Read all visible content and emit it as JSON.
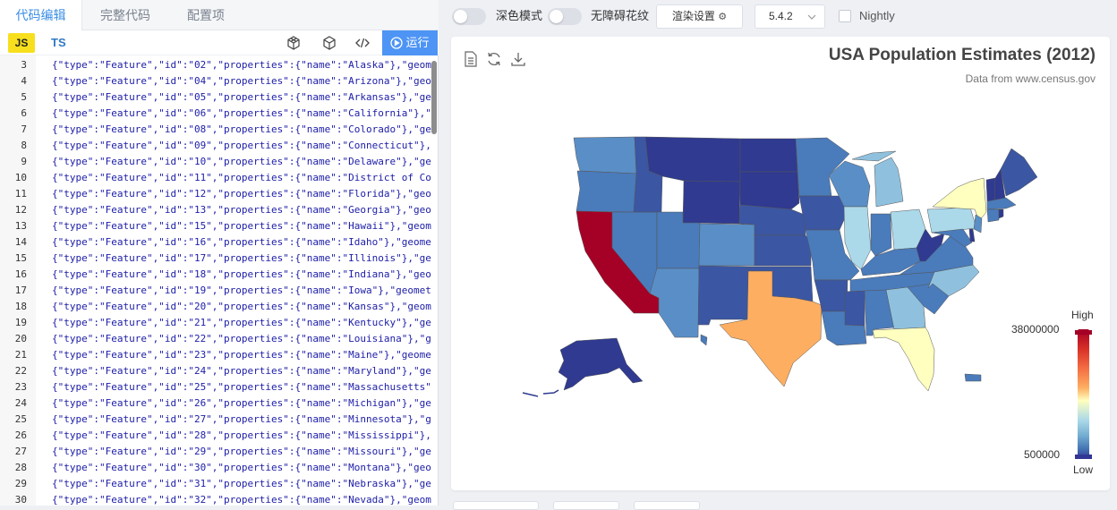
{
  "editor": {
    "tabs": [
      "代码编辑",
      "完整代码",
      "配置项"
    ],
    "lang_js": "JS",
    "lang_ts": "TS",
    "run_label": "运行",
    "code_lines": [
      {
        "num": "3",
        "text": "{\"type\":\"Feature\",\"id\":\"02\",\"properties\":{\"name\":\"Alaska\"},\"geometry\""
      },
      {
        "num": "4",
        "text": "{\"type\":\"Feature\",\"id\":\"04\",\"properties\":{\"name\":\"Arizona\"},\"geometry\""
      },
      {
        "num": "5",
        "text": "{\"type\":\"Feature\",\"id\":\"05\",\"properties\":{\"name\":\"Arkansas\"},\"geometry\""
      },
      {
        "num": "6",
        "text": "{\"type\":\"Feature\",\"id\":\"06\",\"properties\":{\"name\":\"California\"},\"geometry\""
      },
      {
        "num": "7",
        "text": "{\"type\":\"Feature\",\"id\":\"08\",\"properties\":{\"name\":\"Colorado\"},\"geometry\""
      },
      {
        "num": "8",
        "text": "{\"type\":\"Feature\",\"id\":\"09\",\"properties\":{\"name\":\"Connecticut\"},"
      },
      {
        "num": "9",
        "text": "{\"type\":\"Feature\",\"id\":\"10\",\"properties\":{\"name\":\"Delaware\"},\"geometry\""
      },
      {
        "num": "10",
        "text": "{\"type\":\"Feature\",\"id\":\"11\",\"properties\":{\"name\":\"District of Columbia\""
      },
      {
        "num": "11",
        "text": "{\"type\":\"Feature\",\"id\":\"12\",\"properties\":{\"name\":\"Florida\"},\"geometry\""
      },
      {
        "num": "12",
        "text": "{\"type\":\"Feature\",\"id\":\"13\",\"properties\":{\"name\":\"Georgia\"},\"geometry\""
      },
      {
        "num": "13",
        "text": "{\"type\":\"Feature\",\"id\":\"15\",\"properties\":{\"name\":\"Hawaii\"},\"geometry\""
      },
      {
        "num": "14",
        "text": "{\"type\":\"Feature\",\"id\":\"16\",\"properties\":{\"name\":\"Idaho\"},\"geometry\""
      },
      {
        "num": "15",
        "text": "{\"type\":\"Feature\",\"id\":\"17\",\"properties\":{\"name\":\"Illinois\"},\"geometry\""
      },
      {
        "num": "16",
        "text": "{\"type\":\"Feature\",\"id\":\"18\",\"properties\":{\"name\":\"Indiana\"},\"geometry\""
      },
      {
        "num": "17",
        "text": "{\"type\":\"Feature\",\"id\":\"19\",\"properties\":{\"name\":\"Iowa\"},\"geometry\""
      },
      {
        "num": "18",
        "text": "{\"type\":\"Feature\",\"id\":\"20\",\"properties\":{\"name\":\"Kansas\"},\"geometry\""
      },
      {
        "num": "19",
        "text": "{\"type\":\"Feature\",\"id\":\"21\",\"properties\":{\"name\":\"Kentucky\"},\"geometry\""
      },
      {
        "num": "20",
        "text": "{\"type\":\"Feature\",\"id\":\"22\",\"properties\":{\"name\":\"Louisiana\"},\"geometry\""
      },
      {
        "num": "21",
        "text": "{\"type\":\"Feature\",\"id\":\"23\",\"properties\":{\"name\":\"Maine\"},\"geometry\""
      },
      {
        "num": "22",
        "text": "{\"type\":\"Feature\",\"id\":\"24\",\"properties\":{\"name\":\"Maryland\"},\"geometry\""
      },
      {
        "num": "23",
        "text": "{\"type\":\"Feature\",\"id\":\"25\",\"properties\":{\"name\":\"Massachusetts\"},"
      },
      {
        "num": "24",
        "text": "{\"type\":\"Feature\",\"id\":\"26\",\"properties\":{\"name\":\"Michigan\"},\"geometry\""
      },
      {
        "num": "25",
        "text": "{\"type\":\"Feature\",\"id\":\"27\",\"properties\":{\"name\":\"Minnesota\"},\"geometry\""
      },
      {
        "num": "26",
        "text": "{\"type\":\"Feature\",\"id\":\"28\",\"properties\":{\"name\":\"Mississippi\"},\"geometry\""
      },
      {
        "num": "27",
        "text": "{\"type\":\"Feature\",\"id\":\"29\",\"properties\":{\"name\":\"Missouri\"},\"geometry\""
      },
      {
        "num": "28",
        "text": "{\"type\":\"Feature\",\"id\":\"30\",\"properties\":{\"name\":\"Montana\"},\"geometry\""
      },
      {
        "num": "29",
        "text": "{\"type\":\"Feature\",\"id\":\"31\",\"properties\":{\"name\":\"Nebraska\"},\"geometry\""
      },
      {
        "num": "30",
        "text": "{\"type\":\"Feature\",\"id\":\"32\",\"properties\":{\"name\":\"Nevada\"},\"geometry\""
      }
    ]
  },
  "toolbar": {
    "dark_mode_label": "深色模式",
    "a11y_label": "无障碍花纹",
    "render_settings_label": "渲染设置",
    "version_label": "5.4.2",
    "nightly_label": "Nightly"
  },
  "chart": {
    "title": "USA Population Estimates (2012)",
    "subtitle": "Data from www.census.gov",
    "visualmap_high": "High",
    "visualmap_low": "Low",
    "visualmap_max": "38000000",
    "visualmap_min": "500000",
    "colors": {
      "max": "#a50026",
      "high": "#f46d43",
      "mid_high": "#fdae61",
      "mid": "#ffffbf",
      "mid_low": "#abd9e9",
      "low_mid": "#74add1",
      "low": "#4575b4",
      "min": "#313695"
    }
  }
}
